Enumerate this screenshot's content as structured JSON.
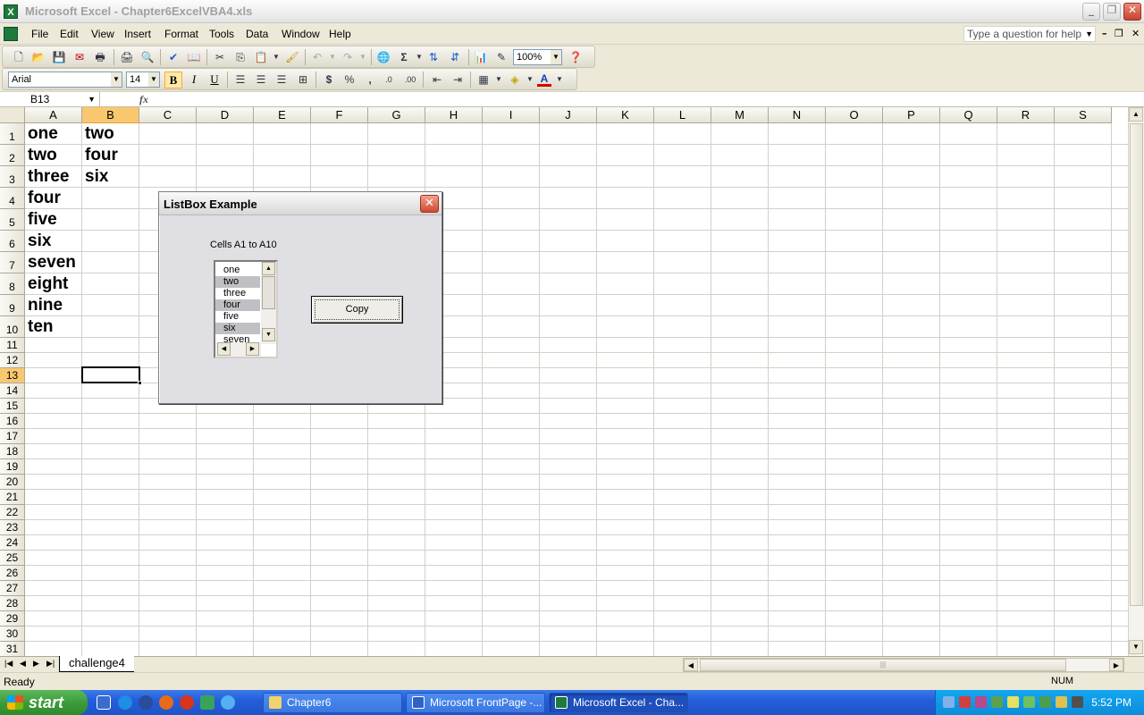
{
  "window": {
    "title": "Microsoft Excel - Chapter6ExcelVBA4.xls",
    "app_icon": "excel-icon"
  },
  "menu": [
    "File",
    "Edit",
    "View",
    "Insert",
    "Format",
    "Tools",
    "Data",
    "Window",
    "Help"
  ],
  "help_box": {
    "placeholder": "Type a question for help"
  },
  "toolbar": {
    "zoom": "100%"
  },
  "format_toolbar": {
    "font": "Arial",
    "size": "14",
    "bold_active": true,
    "font_color": "#d40000",
    "fill_color": "#ffff00"
  },
  "formula_bar": {
    "name_box": "B13",
    "fx": "fx",
    "content": ""
  },
  "columns": [
    "A",
    "B",
    "C",
    "D",
    "E",
    "F",
    "G",
    "H",
    "I",
    "J",
    "K",
    "L",
    "M",
    "N",
    "O",
    "P",
    "Q",
    "R",
    "S"
  ],
  "rows": [
    "1",
    "2",
    "3",
    "4",
    "5",
    "6",
    "7",
    "8",
    "9",
    "10",
    "11",
    "12",
    "13",
    "14",
    "15",
    "16",
    "17",
    "18",
    "19",
    "20",
    "21",
    "22",
    "23",
    "24",
    "25",
    "26",
    "27",
    "28",
    "29",
    "30",
    "31"
  ],
  "cells": {
    "A": [
      "one",
      "two",
      "three",
      "four",
      "five",
      "six",
      "seven",
      "eight",
      "nine",
      "ten"
    ],
    "B": [
      "two",
      "four",
      "six"
    ]
  },
  "selected_cell": "B13",
  "dialog": {
    "title": "ListBox Example",
    "label": "Cells A1 to A10",
    "list_items": [
      "one",
      "two",
      "three",
      "four",
      "five",
      "six",
      "seven"
    ],
    "selected_items": [
      "two",
      "four",
      "six"
    ],
    "button": "Copy"
  },
  "sheet_tab": "challenge4",
  "status": {
    "text": "Ready",
    "num": "NUM"
  },
  "taskbar": {
    "start": "start",
    "tasks": [
      "Chapter6",
      "Microsoft FrontPage -...",
      "Microsoft Excel - Cha..."
    ],
    "clock": "5:52 PM"
  }
}
